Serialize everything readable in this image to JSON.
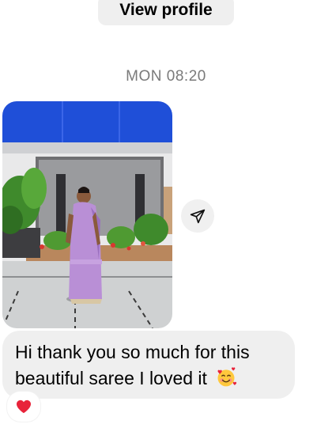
{
  "header": {
    "view_profile_label": "View profile"
  },
  "timestamp": "MON 08:20",
  "message": {
    "text": "Hi thank you so much for this beautiful saree I loved it",
    "emoji_icon": "smiling-face-with-hearts-icon",
    "reaction_icon": "red-heart-icon"
  },
  "photo": {
    "share_icon": "paper-plane-icon"
  },
  "colors": {
    "bubble_bg": "#efefef",
    "timestamp": "#7a7a7a",
    "heart": "#e8233a",
    "awning": "#1f4fd8",
    "saree": "#b98fd6"
  }
}
